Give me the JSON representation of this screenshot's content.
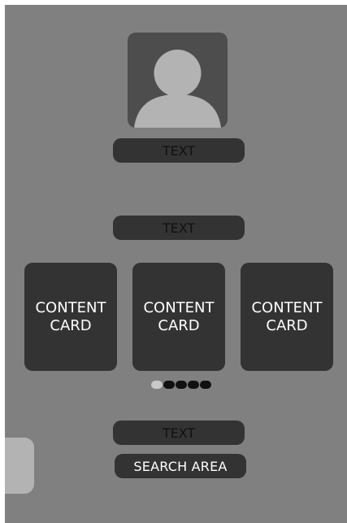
{
  "profile": {
    "avatar_icon": "user-silhouette-icon",
    "name_text": "TEXT"
  },
  "section": {
    "heading_text": "TEXT"
  },
  "cards": [
    {
      "line1": "CONTENT",
      "line2": "CARD"
    },
    {
      "line1": "CONTENT",
      "line2": "CARD"
    },
    {
      "line1": "CONTENT",
      "line2": "CARD"
    }
  ],
  "pagination": {
    "total": 5,
    "active_index": 0
  },
  "footer": {
    "text": "TEXT",
    "search_label": "SEARCH AREA"
  },
  "colors": {
    "background": "#808080",
    "element_dark": "#333333",
    "avatar_bg": "#4d4d4d",
    "avatar_figure": "#b3b3b3",
    "dot_active": "#c8c8c8",
    "dot_inactive": "#111111"
  }
}
